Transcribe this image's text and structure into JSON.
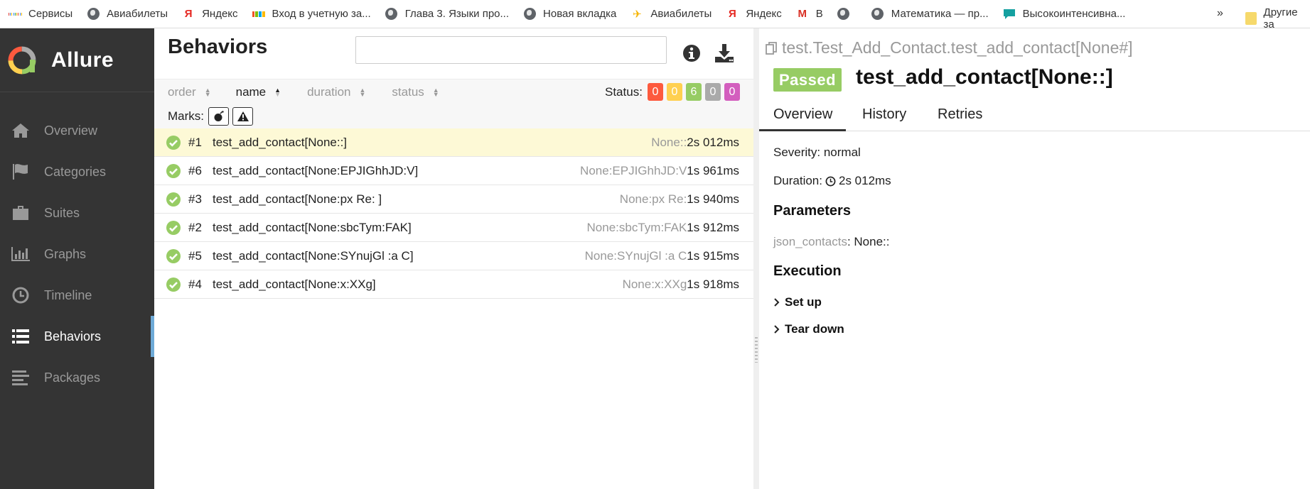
{
  "bookmarks": {
    "items": [
      {
        "label": "Сервисы",
        "icon": "apps-grid-icon"
      },
      {
        "label": "Авиабилеты",
        "icon": "globe-icon"
      },
      {
        "label": "Яндекс",
        "icon": "yandex-icon"
      },
      {
        "label": "Вход в учетную за...",
        "icon": "microsoft-icon"
      },
      {
        "label": "Глава 3. Языки про...",
        "icon": "globe-icon"
      },
      {
        "label": "Новая вкладка",
        "icon": "globe-icon"
      },
      {
        "label": "Авиабилеты",
        "icon": "plane-icon"
      },
      {
        "label": "Яндекс",
        "icon": "yandex-icon"
      },
      {
        "label": "В",
        "icon": "gmail-icon"
      },
      {
        "label": "",
        "icon": "globe-icon"
      },
      {
        "label": "Математика — пр...",
        "icon": "globe-icon"
      },
      {
        "label": "Высокоинтенсивна...",
        "icon": "chat-icon"
      }
    ],
    "more": "»",
    "other": "Другие за"
  },
  "sidebar": {
    "brand": "Allure",
    "items": [
      {
        "label": "Overview",
        "icon": "home-icon"
      },
      {
        "label": "Categories",
        "icon": "flag-icon"
      },
      {
        "label": "Suites",
        "icon": "briefcase-icon"
      },
      {
        "label": "Graphs",
        "icon": "bar-chart-icon"
      },
      {
        "label": "Timeline",
        "icon": "clock-icon"
      },
      {
        "label": "Behaviors",
        "icon": "list-icon",
        "active": true
      },
      {
        "label": "Packages",
        "icon": "align-left-icon"
      }
    ]
  },
  "tree": {
    "title": "Behaviors",
    "search_placeholder": "",
    "sorters": [
      "order",
      "name",
      "duration",
      "status"
    ],
    "status_label": "Status:",
    "counts": [
      {
        "value": "0",
        "color": "#fd5a3e"
      },
      {
        "value": "0",
        "color": "#ffd050"
      },
      {
        "value": "6",
        "color": "#97cc64"
      },
      {
        "value": "0",
        "color": "#aaaaaa"
      },
      {
        "value": "0",
        "color": "#d35ebe"
      }
    ],
    "marks_label": "Marks:",
    "rows": [
      {
        "num": "#1",
        "name": "test_add_contact[None::]",
        "param": "None::",
        "duration": "2s 012ms",
        "selected": true
      },
      {
        "num": "#6",
        "name": "test_add_contact[None:EPJIGhhJD:V]",
        "param": "None:EPJIGhhJD:V",
        "duration": "1s 961ms"
      },
      {
        "num": "#3",
        "name": "test_add_contact[None:px Re: ]",
        "param": "None:px Re:",
        "duration": "1s 940ms"
      },
      {
        "num": "#2",
        "name": "test_add_contact[None:sbcTym:FAK]",
        "param": "None:sbcTym:FAK",
        "duration": "1s 912ms"
      },
      {
        "num": "#5",
        "name": "test_add_contact[None:SYnujGl :a C]",
        "param": "None:SYnujGl :a C",
        "duration": "1s 915ms"
      },
      {
        "num": "#4",
        "name": "test_add_contact[None:x:XXg]",
        "param": "None:x:XXg",
        "duration": "1s 918ms"
      }
    ]
  },
  "detail": {
    "fullname": "test.Test_Add_Contact.test_add_contact[None#]",
    "status": "Passed",
    "status_color": "#97cc64",
    "name": "test_add_contact[None::]",
    "tabs": [
      "Overview",
      "History",
      "Retries"
    ],
    "severity": "Severity: normal",
    "duration_label": "Duration:",
    "duration_value": "2s 012ms",
    "parameters_title": "Parameters",
    "param_key": "json_contacts",
    "param_value": ": None::",
    "execution_title": "Execution",
    "steps": [
      "Set up",
      "Tear down"
    ]
  }
}
